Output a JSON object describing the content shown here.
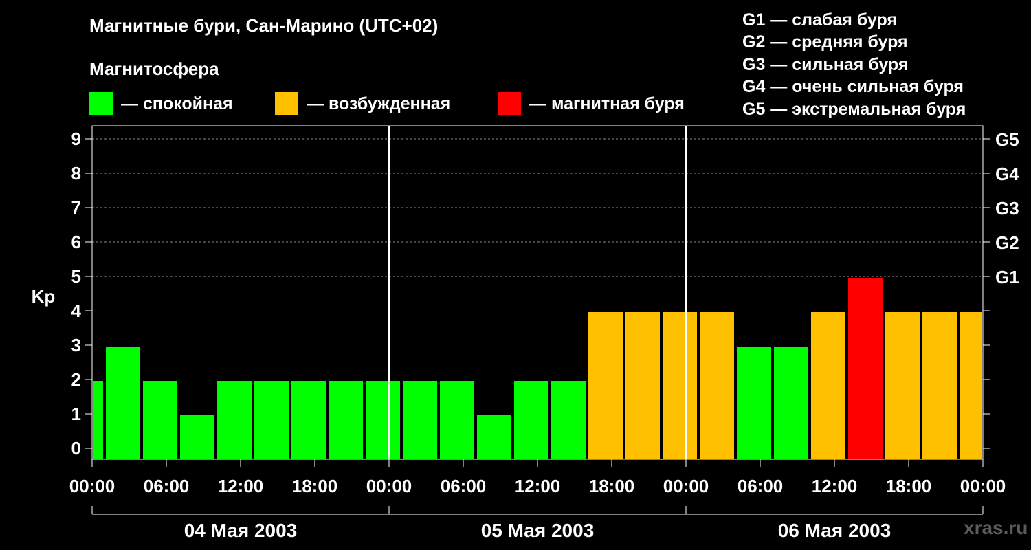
{
  "header": {
    "title": "Магнитные бури, Сан-Марино (UTC+02)",
    "subtitle": "Магнитосфера"
  },
  "legend": {
    "items": [
      {
        "label": "— спокойная",
        "color": "#00ff00"
      },
      {
        "label": "— возбужденная",
        "color": "#ffc000"
      },
      {
        "label": "— магнитная буря",
        "color": "#ff0000"
      }
    ]
  },
  "g_scale_legend": [
    "G1 — слабая буря",
    "G2 — средняя буря",
    "G3 — сильная буря",
    "G4 — очень сильная буря",
    "G5 — экстремальная буря"
  ],
  "watermark": "xras.ru",
  "chart_data": {
    "type": "bar",
    "ylabel": "Kp",
    "ylim": [
      0,
      9
    ],
    "y_ticks": [
      0,
      1,
      2,
      3,
      4,
      5,
      6,
      7,
      8,
      9
    ],
    "right_ticks": [
      {
        "y": 5,
        "label": "G1"
      },
      {
        "y": 6,
        "label": "G2"
      },
      {
        "y": 7,
        "label": "G3"
      },
      {
        "y": 8,
        "label": "G4"
      },
      {
        "y": 9,
        "label": "G5"
      }
    ],
    "x_range_hours": [
      0,
      72
    ],
    "x_ticks": [
      "00:00",
      "06:00",
      "12:00",
      "18:00",
      "00:00",
      "06:00",
      "12:00",
      "18:00",
      "00:00",
      "06:00",
      "12:00",
      "18:00",
      "00:00"
    ],
    "days": [
      "04 Мая 2003",
      "05 Мая 2003",
      "06 Мая 2003"
    ],
    "grid": true,
    "colors": {
      "quiet": "#00ff00",
      "active": "#ffc000",
      "storm": "#ff0000"
    },
    "bars": [
      {
        "start": "04 Мая 2003 00:00",
        "end": "04 Мая 2003 01:00",
        "kp": 2,
        "level": "quiet"
      },
      {
        "start": "04 Мая 2003 01:00",
        "end": "04 Мая 2003 04:00",
        "kp": 3,
        "level": "quiet"
      },
      {
        "start": "04 Мая 2003 04:00",
        "end": "04 Мая 2003 07:00",
        "kp": 2,
        "level": "quiet"
      },
      {
        "start": "04 Мая 2003 07:00",
        "end": "04 Мая 2003 10:00",
        "kp": 1,
        "level": "quiet"
      },
      {
        "start": "04 Мая 2003 10:00",
        "end": "04 Мая 2003 13:00",
        "kp": 2,
        "level": "quiet"
      },
      {
        "start": "04 Мая 2003 13:00",
        "end": "04 Мая 2003 16:00",
        "kp": 2,
        "level": "quiet"
      },
      {
        "start": "04 Мая 2003 16:00",
        "end": "04 Мая 2003 19:00",
        "kp": 2,
        "level": "quiet"
      },
      {
        "start": "04 Мая 2003 19:00",
        "end": "04 Мая 2003 22:00",
        "kp": 2,
        "level": "quiet"
      },
      {
        "start": "04 Мая 2003 22:00",
        "end": "05 Мая 2003 01:00",
        "kp": 2,
        "level": "quiet"
      },
      {
        "start": "05 Мая 2003 01:00",
        "end": "05 Мая 2003 04:00",
        "kp": 2,
        "level": "quiet"
      },
      {
        "start": "05 Мая 2003 04:00",
        "end": "05 Мая 2003 07:00",
        "kp": 2,
        "level": "quiet"
      },
      {
        "start": "05 Мая 2003 07:00",
        "end": "05 Мая 2003 10:00",
        "kp": 1,
        "level": "quiet"
      },
      {
        "start": "05 Мая 2003 10:00",
        "end": "05 Мая 2003 13:00",
        "kp": 2,
        "level": "quiet"
      },
      {
        "start": "05 Мая 2003 13:00",
        "end": "05 Мая 2003 16:00",
        "kp": 2,
        "level": "quiet"
      },
      {
        "start": "05 Мая 2003 16:00",
        "end": "05 Мая 2003 19:00",
        "kp": 4,
        "level": "active"
      },
      {
        "start": "05 Мая 2003 19:00",
        "end": "05 Мая 2003 22:00",
        "kp": 4,
        "level": "active"
      },
      {
        "start": "05 Мая 2003 22:00",
        "end": "06 Мая 2003 01:00",
        "kp": 4,
        "level": "active"
      },
      {
        "start": "06 Мая 2003 01:00",
        "end": "06 Мая 2003 04:00",
        "kp": 4,
        "level": "active"
      },
      {
        "start": "06 Мая 2003 04:00",
        "end": "06 Мая 2003 07:00",
        "kp": 3,
        "level": "quiet"
      },
      {
        "start": "06 Мая 2003 07:00",
        "end": "06 Мая 2003 10:00",
        "kp": 3,
        "level": "quiet"
      },
      {
        "start": "06 Мая 2003 10:00",
        "end": "06 Мая 2003 13:00",
        "kp": 4,
        "level": "active"
      },
      {
        "start": "06 Мая 2003 13:00",
        "end": "06 Мая 2003 16:00",
        "kp": 5,
        "level": "storm"
      },
      {
        "start": "06 Мая 2003 16:00",
        "end": "06 Мая 2003 19:00",
        "kp": 4,
        "level": "active"
      },
      {
        "start": "06 Мая 2003 19:00",
        "end": "06 Мая 2003 22:00",
        "kp": 4,
        "level": "active"
      },
      {
        "start": "06 Мая 2003 22:00",
        "end": "07 Мая 2003 00:00",
        "kp": 4,
        "level": "active"
      }
    ]
  }
}
